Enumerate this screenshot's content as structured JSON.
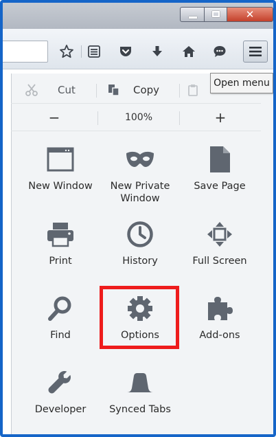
{
  "window_controls": {
    "minimize": "minimize",
    "maximize": "maximize",
    "close": "✕"
  },
  "toolbar": {
    "icons": [
      "star-icon",
      "reading-list-icon",
      "pocket-icon",
      "download-icon",
      "home-icon",
      "chat-icon"
    ],
    "menu_icon": "hamburger-menu-icon"
  },
  "tooltip": {
    "text": "Open menu"
  },
  "edit_row": {
    "cut": "Cut",
    "copy": "Copy",
    "paste": "Paste"
  },
  "zoom_row": {
    "minus": "−",
    "level": "100%",
    "plus": "+"
  },
  "tiles": [
    {
      "label": "New Window",
      "icon": "window-icon"
    },
    {
      "label": "New Private\nWindow",
      "icon": "mask-icon"
    },
    {
      "label": "Save Page",
      "icon": "page-icon"
    },
    {
      "label": "Print",
      "icon": "printer-icon"
    },
    {
      "label": "History",
      "icon": "clock-icon"
    },
    {
      "label": "Full Screen",
      "icon": "fullscreen-icon"
    },
    {
      "label": "Find",
      "icon": "magnifier-icon"
    },
    {
      "label": "Options",
      "icon": "gear-icon"
    },
    {
      "label": "Add-ons",
      "icon": "puzzle-icon"
    },
    {
      "label": "Developer",
      "icon": "wrench-icon"
    },
    {
      "label": "Synced Tabs",
      "icon": "synced-tabs-icon"
    }
  ],
  "colors": {
    "frame_border": "#1565c8",
    "highlight": "#ee1c1c",
    "icon_gray": "#5f6670"
  }
}
